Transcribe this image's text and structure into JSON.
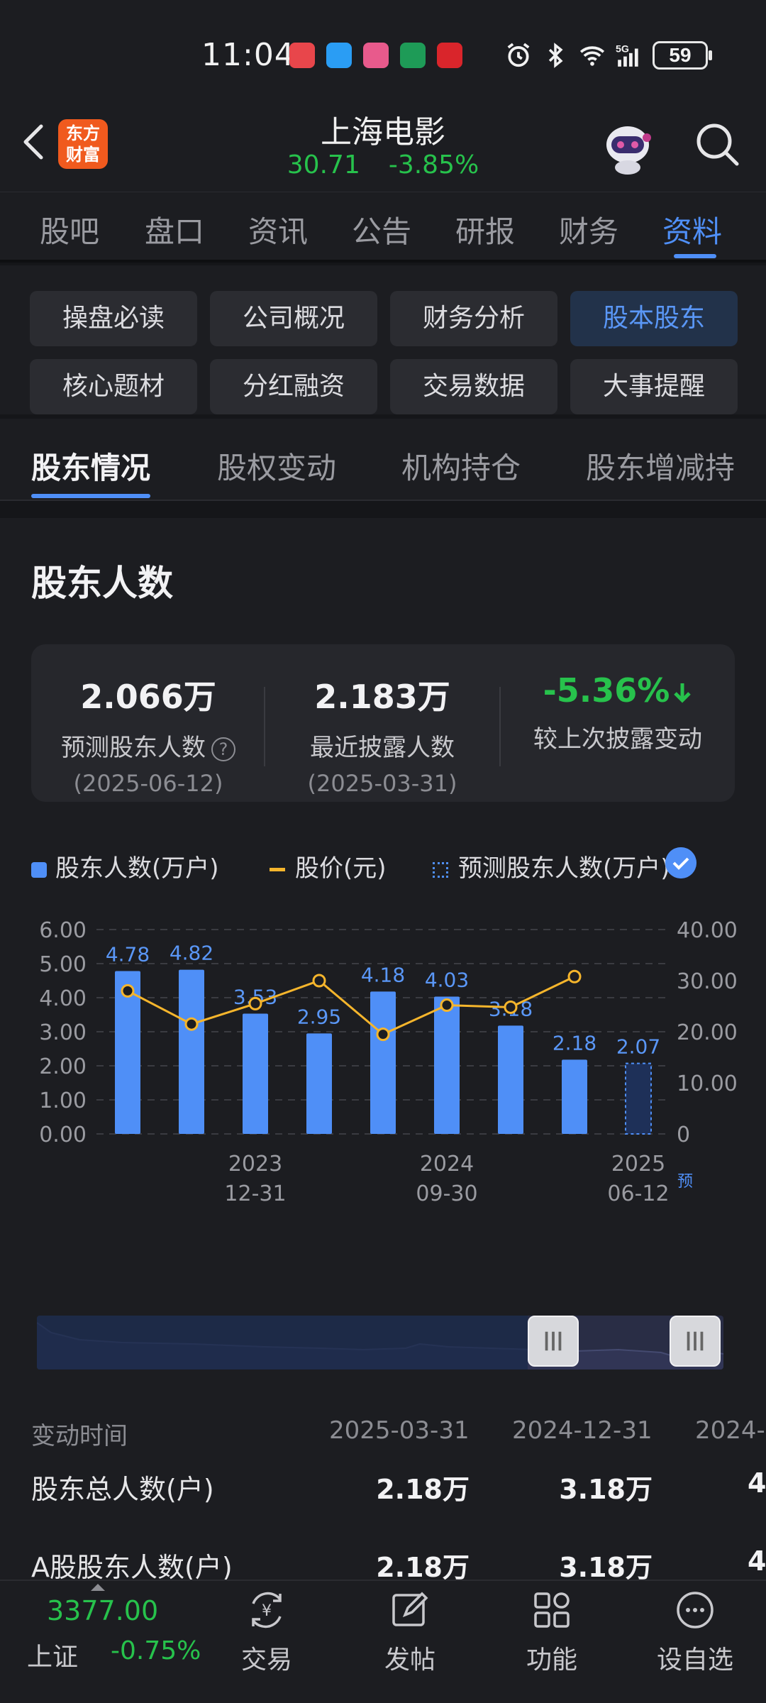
{
  "status_bar": {
    "time": "11:04",
    "battery": "59",
    "notification_apps": [
      "huawei-store",
      "messages",
      "game-app",
      "china-post",
      "pay-app"
    ]
  },
  "header": {
    "stock_name": "上海电影",
    "price": "30.71",
    "change_pct": "-3.85%",
    "logo_text": "东方财富"
  },
  "main_tabs": [
    "股吧",
    "盘口",
    "资讯",
    "公告",
    "研报",
    "财务",
    "资料"
  ],
  "main_tab_active": "资料",
  "chips": [
    "操盘必读",
    "公司概况",
    "财务分析",
    "股本股东",
    "核心题材",
    "分红融资",
    "交易数据",
    "大事提醒"
  ],
  "chip_active": "股本股东",
  "sub_tabs": [
    "股东情况",
    "股权变动",
    "机构持仓",
    "股东增减持"
  ],
  "sub_tab_active": "股东情况",
  "section": {
    "title": "股东人数",
    "summary": {
      "forecast_value": "2.066万",
      "forecast_label": "预测股东人数",
      "forecast_date": "(2025-06-12)",
      "latest_value": "2.183万",
      "latest_label": "最近披露人数",
      "latest_date": "(2025-03-31)",
      "change_value": "-5.36%",
      "change_label": "较上次披露变动",
      "help_glyph": "?"
    },
    "legend": {
      "holders": "股东人数(万户)",
      "price": "股价(元)",
      "forecast": "预测股东人数(万户)"
    }
  },
  "chart_data": {
    "type": "bar",
    "y_left_ticks": [
      "6.00",
      "5.00",
      "4.00",
      "3.00",
      "2.00",
      "1.00",
      "0.00"
    ],
    "y_right_ticks": [
      "40.00",
      "30.00",
      "20.00",
      "10.00",
      "0"
    ],
    "ylim_left": [
      0,
      6
    ],
    "ylim_right": [
      0,
      40
    ],
    "x_tick_labels": [
      {
        "top": "2023",
        "bottom": "12-31"
      },
      {
        "top": "2024",
        "bottom": "09-30"
      },
      {
        "top": "2025",
        "bottom": "06-12"
      }
    ],
    "forecast_marker": "预",
    "series": [
      {
        "name": "股东人数(万户)",
        "values": [
          4.78,
          4.82,
          3.53,
          2.95,
          4.18,
          4.03,
          3.18,
          2.18
        ],
        "labels": [
          "4.78",
          "4.82",
          "3.53",
          "2.95",
          "4.18",
          "4.03",
          "3.18",
          "2.18"
        ]
      },
      {
        "name": "股价(元)",
        "values": [
          28,
          21.5,
          25.5,
          30,
          19.5,
          25.2,
          24.8,
          30.8
        ]
      },
      {
        "name": "预测股东人数(万户)",
        "values": [
          null,
          null,
          null,
          null,
          null,
          null,
          null,
          null,
          2.07
        ],
        "labels": [
          "2.07"
        ]
      }
    ],
    "colors": {
      "bar": "#4f8ff7",
      "line": "#f5b52c",
      "label": "#5a97f7"
    },
    "grid": true
  },
  "table": {
    "header_label": "变动时间",
    "columns": [
      "2025-03-31",
      "2024-12-31",
      "2024-"
    ],
    "rows": [
      {
        "label": "股东总人数(户)",
        "values": [
          "2.18万",
          "3.18万",
          "4."
        ]
      },
      {
        "label": "A股股东人数(户)",
        "values": [
          "2.18万",
          "3.18万",
          "4."
        ]
      }
    ]
  },
  "bottom_bar": {
    "index_value": "3377.00",
    "index_name": "上证",
    "index_change": "-0.75%",
    "buttons": [
      "交易",
      "发帖",
      "功能",
      "设自选"
    ]
  }
}
